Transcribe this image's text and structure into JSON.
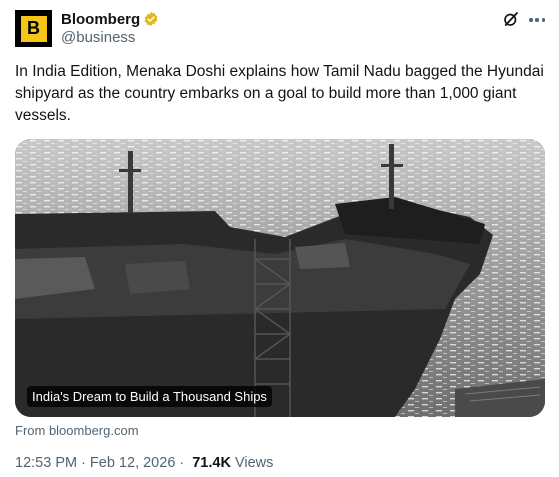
{
  "author": {
    "display_name": "Bloomberg",
    "handle": "@business",
    "avatar_letter": "B",
    "avatar_bg": "#000000",
    "avatar_accent": "#f5c518",
    "verified_color": "#e2b719"
  },
  "tweet": {
    "text": "In India Edition, Menaka Doshi explains how Tamil Nadu bagged the Hyundai shipyard as the country embarks on a goal to build more than 1,000 giant vessels."
  },
  "card": {
    "title": "India's Dream to Build a Thousand Ships",
    "source": "From bloomberg.com"
  },
  "meta": {
    "time": "12:53 PM",
    "separator": "·",
    "date": "Feb 12, 2026",
    "views_count": "71.4K",
    "views_label": "Views"
  },
  "icons": {
    "grok": "grok-icon",
    "more": "more-options-icon",
    "verified": "verified-badge-icon"
  }
}
